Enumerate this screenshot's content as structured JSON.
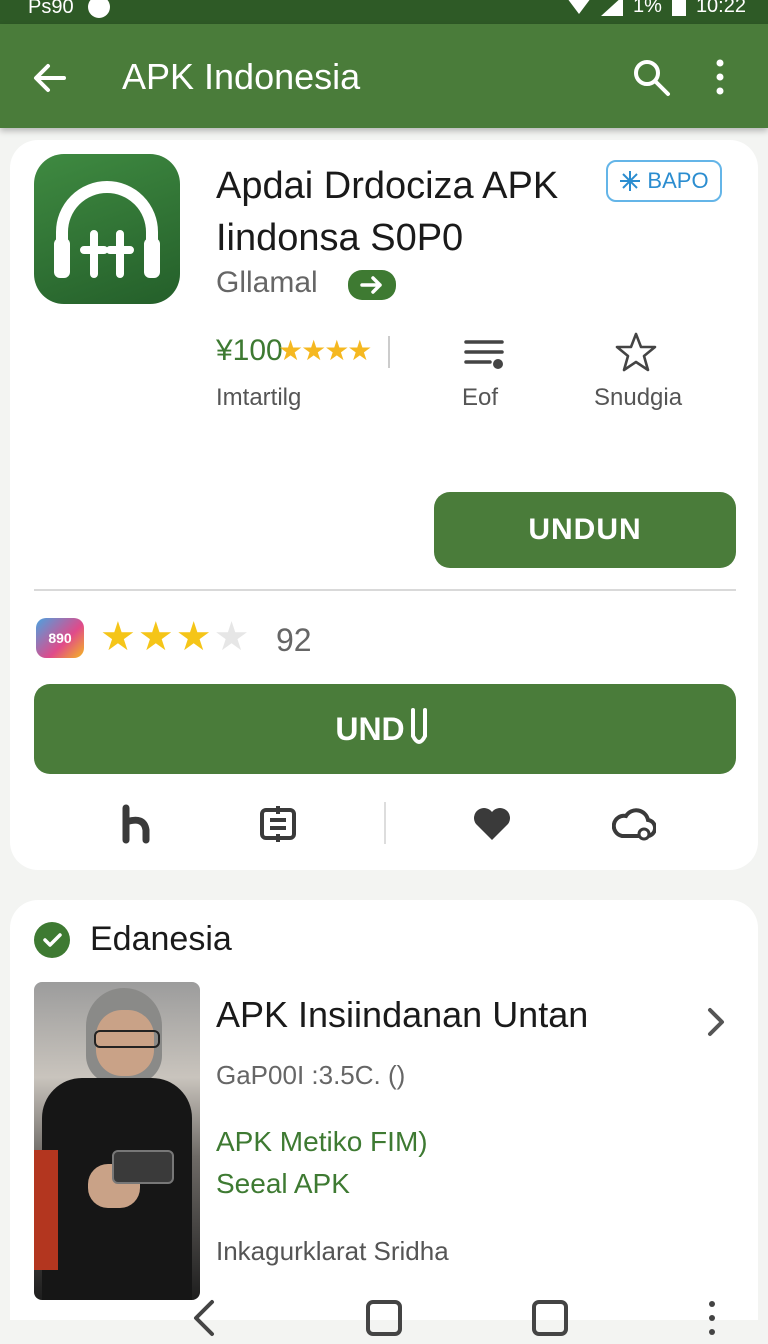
{
  "status_bar": {
    "left_text": "Ps90",
    "battery_text": "1%",
    "time": "10:22"
  },
  "app_bar": {
    "title": "APK Indonesia",
    "back_icon": "arrow-left-icon",
    "search_icon": "search-icon",
    "more_icon": "more-vert-icon"
  },
  "app": {
    "name_line1": "Apdai Drdociza APK",
    "name_line2": "Iindonsa S0P0",
    "badge": "BAPO",
    "developer": "Gllamal",
    "rating_value": "¥100",
    "rating_stars": "★★★★",
    "stats": [
      {
        "label": "Imtartilg"
      },
      {
        "label": "Eof",
        "icon": "list-icon"
      },
      {
        "label": "Snudgia",
        "icon": "star-outline-icon"
      }
    ],
    "install_label": "UNDUN"
  },
  "review": {
    "logo_text": "890",
    "stars_filled": 3,
    "stars_total": 4,
    "count": "92",
    "download_label": "UND"
  },
  "actions": [
    {
      "icon": "share-icon"
    },
    {
      "icon": "compare-icon"
    },
    {
      "icon": "heart-icon"
    },
    {
      "icon": "cloud-icon"
    }
  ],
  "section": {
    "title": "Edanesia",
    "item": {
      "title": "APK Insiindanan Untan",
      "meta": "GaP00I :3.5C. ()",
      "link1": "APK Metiko FIM)",
      "link2": "Seeal APK",
      "footer": "Inkagurklarat Sridha"
    }
  },
  "colors": {
    "primary": "#4a7c3a",
    "status": "#2e5a26",
    "star": "#f5c518",
    "badge": "#2b8dd0"
  }
}
